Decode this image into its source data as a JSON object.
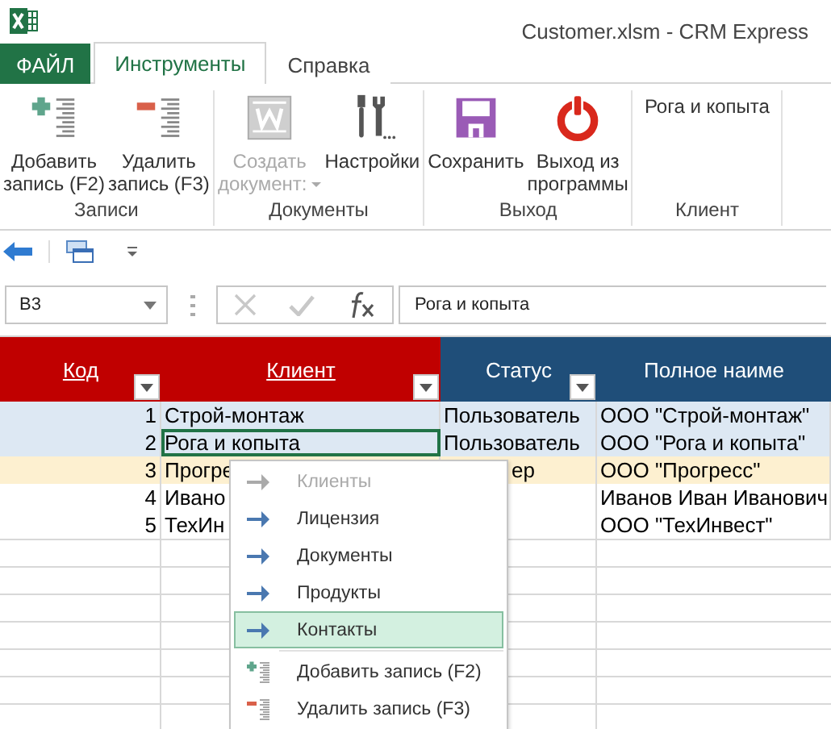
{
  "window": {
    "title": "Customer.xlsm - CRM Express"
  },
  "tabs": [
    {
      "label": "ФАЙЛ",
      "kind": "file",
      "selected": false
    },
    {
      "label": "Инструменты",
      "kind": "tab",
      "selected": true
    },
    {
      "label": "Справка",
      "kind": "tab",
      "selected": false
    }
  ],
  "ribbon": {
    "groups": [
      {
        "label": "Записи",
        "buttons": [
          {
            "label": "Добавить\nзапись (F2)",
            "kind": "add",
            "disabled": false
          },
          {
            "label": "Удалить\nзапись (F3)",
            "kind": "delete",
            "disabled": false
          }
        ]
      },
      {
        "label": "Документы",
        "buttons": [
          {
            "label": "Создать\nдокумент:",
            "kind": "document",
            "disabled": true,
            "dropdown": true
          },
          {
            "label": "Настройки",
            "kind": "tools",
            "disabled": false
          }
        ]
      },
      {
        "label": "Выход",
        "buttons": [
          {
            "label": "Сохранить",
            "kind": "save",
            "disabled": false
          },
          {
            "label": "Выход из\nпрограммы",
            "kind": "power",
            "disabled": false
          }
        ]
      },
      {
        "label": "Клиент",
        "text": "Рога и копыта"
      }
    ]
  },
  "formula_bar": {
    "cell": "B3",
    "value": "Рога и копыта"
  },
  "table": {
    "columns": [
      {
        "label": "Код",
        "link": true,
        "filter": true
      },
      {
        "label": "Клиент",
        "link": true,
        "filter": true
      },
      {
        "label": "Статус",
        "link": false,
        "filter": true
      },
      {
        "label": "Полное наиме",
        "link": false,
        "filter": false
      }
    ],
    "rows": [
      {
        "code": "1",
        "client": "Строй-монтаж",
        "status": "Пользователь",
        "full_name": "ООО \"Строй-монтаж\"",
        "color": "#dde8f3",
        "selected": false
      },
      {
        "code": "2",
        "client": "Рога и копыта",
        "status": "Пользователь",
        "full_name": "ООО \"Рога и копыта\"",
        "color": "#dde8f3",
        "selected": true
      },
      {
        "code": "3",
        "client": "Прогре",
        "status": "ер",
        "full_name": "ООО \"Прогресс\"",
        "color": "#fdf0d0",
        "selected": false
      },
      {
        "code": "4",
        "client": "Ивано",
        "status": "",
        "full_name": "Иванов Иван Иванович",
        "color": "#ffffff",
        "selected": false
      },
      {
        "code": "5",
        "client": "ТехИн",
        "status": "",
        "full_name": "ООО \"ТехИнвест\"",
        "color": "#ffffff",
        "selected": false
      }
    ]
  },
  "context_menu": {
    "items": [
      {
        "label": "Клиенты",
        "kind": "arrow",
        "disabled": true,
        "selected": false
      },
      {
        "label": "Лицензия",
        "kind": "arrow",
        "disabled": false,
        "selected": false
      },
      {
        "label": "Документы",
        "kind": "arrow",
        "disabled": false,
        "selected": false
      },
      {
        "label": "Продукты",
        "kind": "arrow",
        "disabled": false,
        "selected": false
      },
      {
        "label": "Контакты",
        "kind": "arrow",
        "disabled": false,
        "selected": true
      },
      {
        "label": "Добавить запись (F2)",
        "kind": "add",
        "disabled": false,
        "selected": false
      },
      {
        "label": "Удалить запись (F3)",
        "kind": "delete",
        "disabled": false,
        "selected": false
      }
    ]
  }
}
